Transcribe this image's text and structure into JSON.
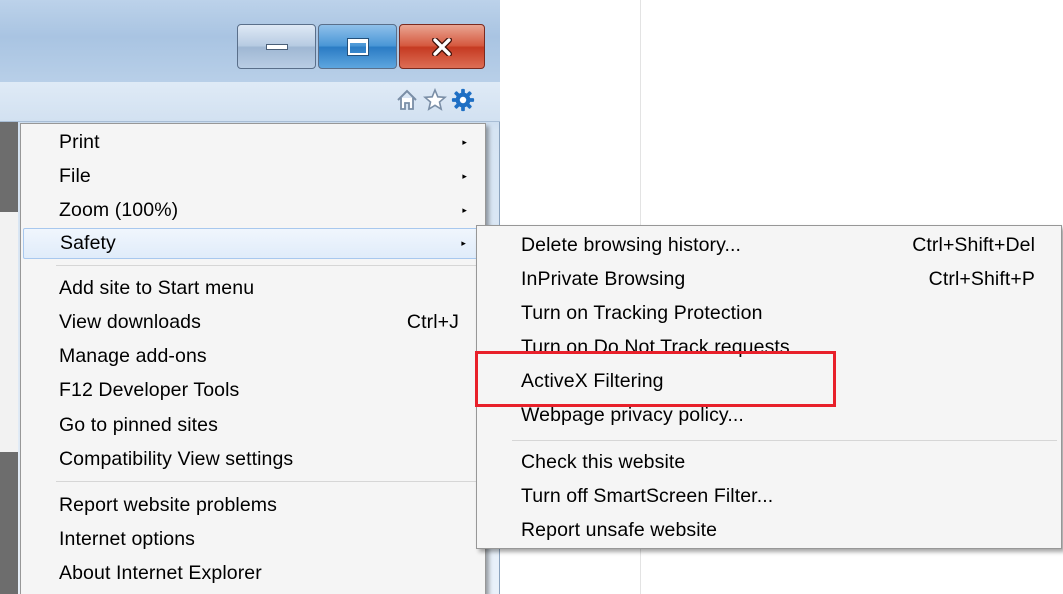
{
  "window": {
    "caption_buttons": [
      "minimize-icon",
      "maximize-icon",
      "close-icon"
    ],
    "toolbar_icons": [
      "home-icon",
      "favorites-star-icon",
      "tools-gear-icon"
    ],
    "colors": {
      "close": "#c53a22",
      "maximize": "#2b7cc4",
      "gear": "#1e6fc4",
      "highlight": "#e8202a"
    }
  },
  "main_menu": {
    "items": [
      {
        "label": "Print",
        "arrow": "▸"
      },
      {
        "label": "File",
        "arrow": "▸"
      },
      {
        "label": "Zoom (100%)",
        "arrow": "▸"
      },
      {
        "label": "Safety",
        "arrow": "▸",
        "selected": true
      },
      {
        "label": "Add site to Start menu"
      },
      {
        "label": "View downloads",
        "shortcut": "Ctrl+J"
      },
      {
        "label": "Manage add-ons"
      },
      {
        "label": "F12 Developer Tools"
      },
      {
        "label": "Go to pinned sites"
      },
      {
        "label": "Compatibility View settings"
      },
      {
        "label": "Report website problems"
      },
      {
        "label": "Internet options"
      },
      {
        "label": "About Internet Explorer"
      }
    ]
  },
  "safety_submenu": {
    "items": [
      {
        "label": "Delete browsing history...",
        "shortcut": "Ctrl+Shift+Del"
      },
      {
        "label": "InPrivate Browsing",
        "shortcut": "Ctrl+Shift+P"
      },
      {
        "label": "Turn on Tracking Protection"
      },
      {
        "label": "Turn on Do Not Track requests"
      },
      {
        "label": "ActiveX Filtering",
        "highlighted": true
      },
      {
        "label": "Webpage privacy policy..."
      },
      {
        "label": "Check this website"
      },
      {
        "label": "Turn off SmartScreen Filter..."
      },
      {
        "label": "Report unsafe website"
      }
    ]
  }
}
